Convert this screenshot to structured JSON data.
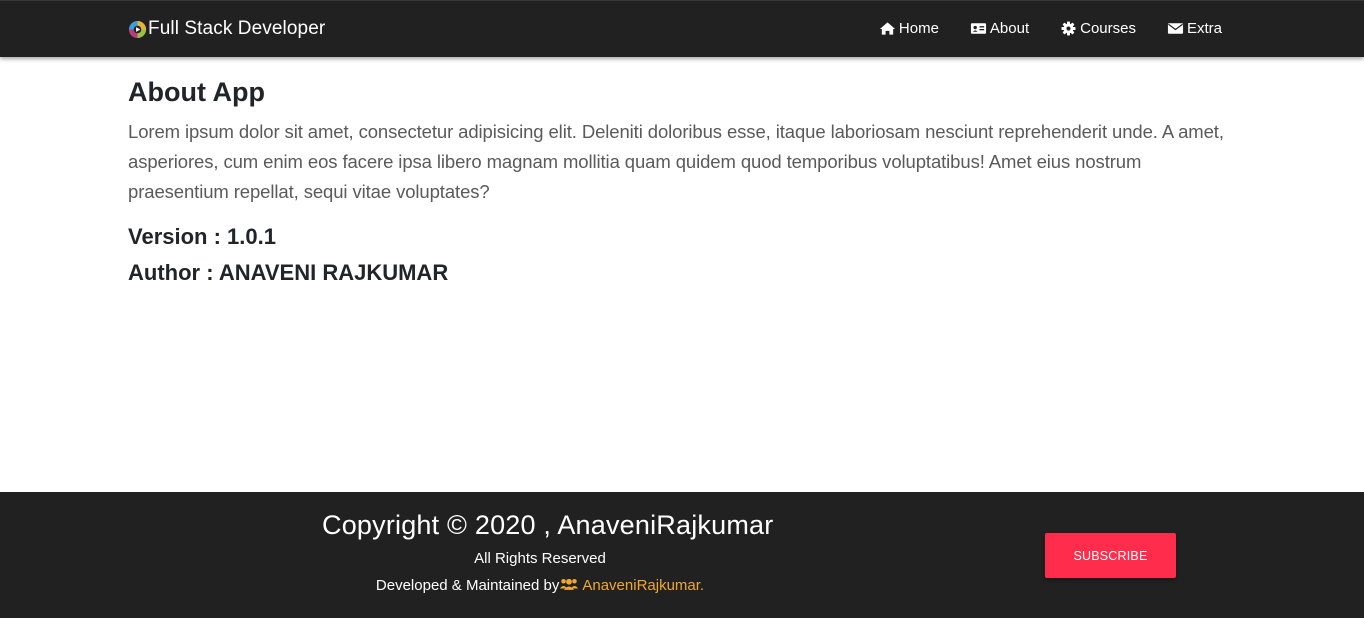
{
  "navbar": {
    "brand": "Full Stack Developer",
    "logo_icon": "brand-logo-icon",
    "items": [
      {
        "label": "Home",
        "icon": "home-icon"
      },
      {
        "label": "About",
        "icon": "id-card-icon"
      },
      {
        "label": "Courses",
        "icon": "gear-icon"
      },
      {
        "label": "Extra",
        "icon": "envelope-icon"
      }
    ]
  },
  "main": {
    "title": "About App",
    "description": "Lorem ipsum dolor sit amet, consectetur adipisicing elit. Deleniti doloribus esse, itaque laboriosam nesciunt reprehenderit unde. A amet, asperiores, cum enim eos facere ipsa libero magnam mollitia quam quidem quod temporibus voluptatibus! Amet eius nostrum praesentium repellat, sequi vitae voluptates?",
    "version": "Version : 1.0.1",
    "author": "Author : ANAVENI RAJKUMAR"
  },
  "footer": {
    "copyright": "Copyright © 2020 , AnaveniRajkumar",
    "rights": "All Rights Reserved",
    "developed_by_prefix": "Developed & Maintained by",
    "developer_link": "AnaveniRajkumar.",
    "subscribe_label": "SUBSCRIBE"
  },
  "colors": {
    "navbar_bg": "#212121",
    "footer_bg": "#212121",
    "subscribe_button": "#ff2d4b",
    "developer_link": "#f0a732"
  }
}
